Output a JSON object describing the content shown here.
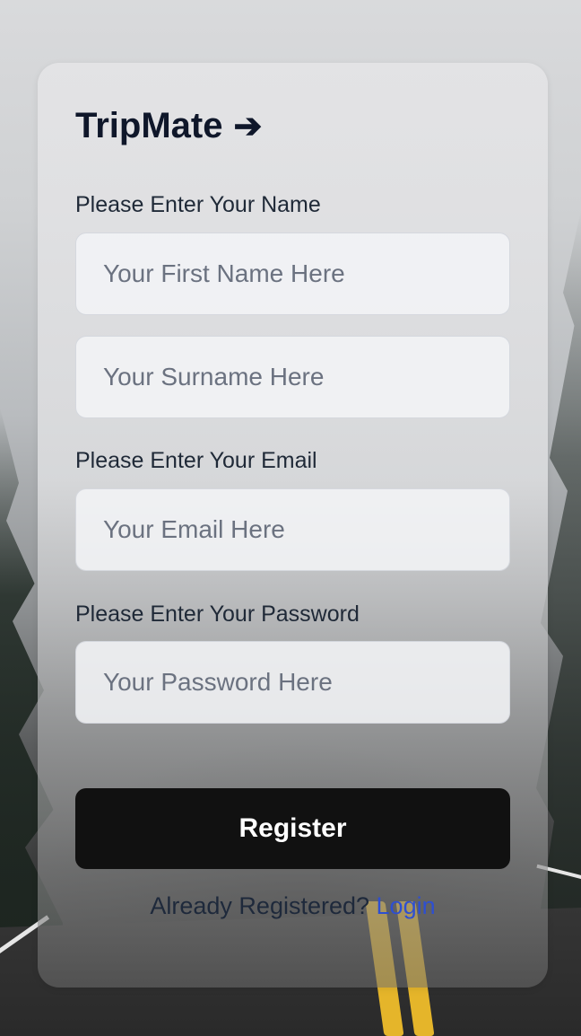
{
  "app": {
    "brand": "TripMate",
    "brand_icon": "arrow-right-icon"
  },
  "form": {
    "name_label": "Please Enter Your Name",
    "first_name_placeholder": "Your First Name Here",
    "surname_placeholder": "Your Surname Here",
    "email_label": "Please Enter Your Email",
    "email_placeholder": "Your Email Here",
    "password_label": "Please Enter Your Password",
    "password_placeholder": "Your Password Here",
    "register_label": "Register"
  },
  "footer": {
    "prompt": "Already Registered?",
    "login_label": "Login"
  },
  "colors": {
    "brand_text": "#0f172a",
    "button_bg": "#111111",
    "link": "#2e4fd1"
  }
}
